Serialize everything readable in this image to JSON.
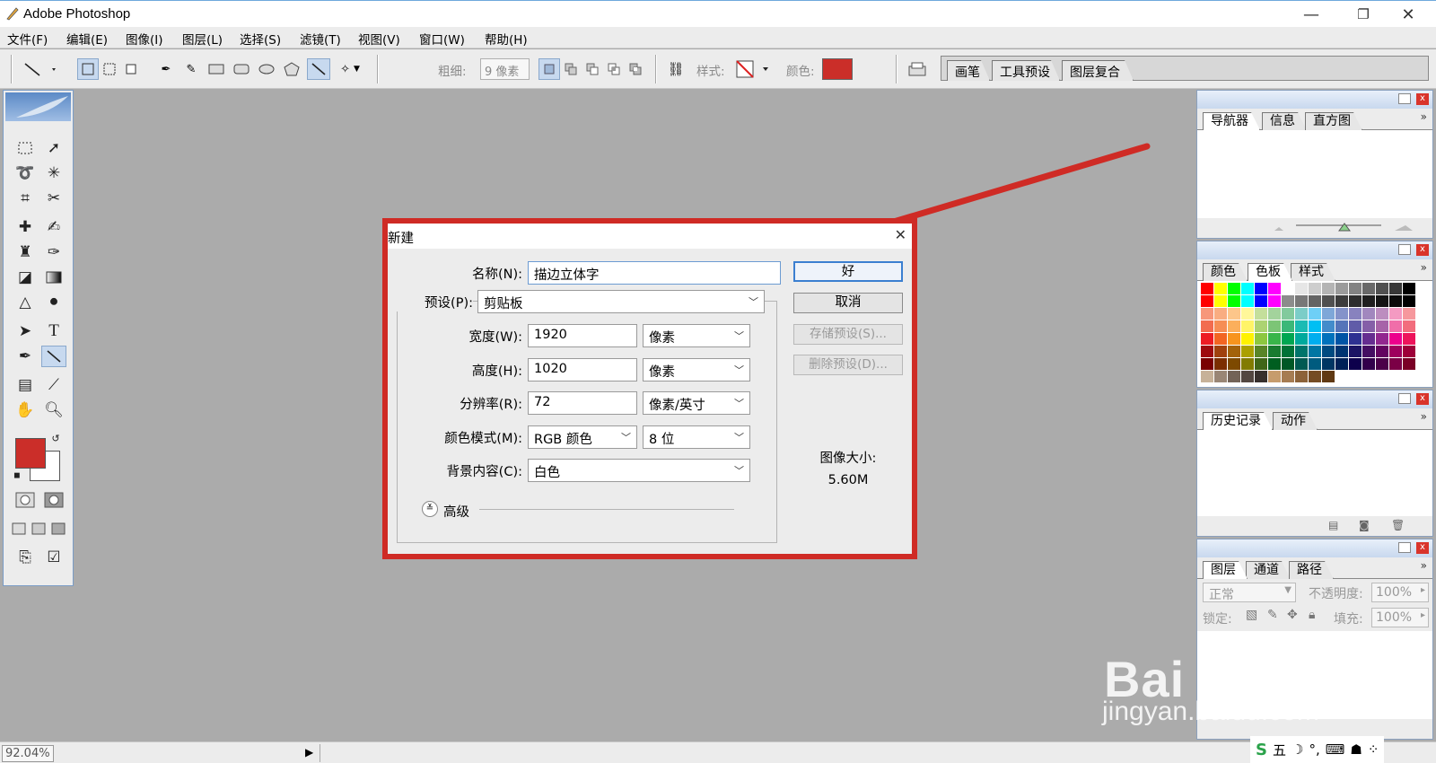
{
  "window": {
    "title": "Adobe Photoshop",
    "minimize": "—",
    "restore": "❐",
    "close": "✕"
  },
  "menu": [
    "文件(F)",
    "编辑(E)",
    "图像(I)",
    "图层(L)",
    "选择(S)",
    "滤镜(T)",
    "视图(V)",
    "窗口(W)",
    "帮助(H)"
  ],
  "options": {
    "weight_label": "粗细:",
    "weight_value": "9 像素",
    "style_label": "样式:",
    "color_label": "颜色:",
    "color_value": "#cb2e29"
  },
  "well_tabs": [
    "画笔",
    "工具预设",
    "图层复合"
  ],
  "status": {
    "zoom": "92.04%"
  },
  "panels": {
    "navigator": {
      "tabs": [
        "导航器",
        "信息",
        "直方图"
      ]
    },
    "swatches": {
      "tabs": [
        "颜色",
        "色板",
        "样式"
      ]
    },
    "history": {
      "tabs": [
        "历史记录",
        "动作"
      ]
    },
    "layers": {
      "tabs": [
        "图层",
        "通道",
        "路径"
      ],
      "blend_mode": "正常",
      "opacity_label": "不透明度:",
      "opacity_value": "100%",
      "lock_label": "锁定:",
      "fill_label": "填充:",
      "fill_value": "100%"
    }
  },
  "dialog": {
    "title": "新建",
    "close": "✕",
    "name_label": "名称(N):",
    "name_value": "描边立体字",
    "preset_label": "预设(P):",
    "preset_value": "剪贴板",
    "width_label": "宽度(W):",
    "width_value": "1920",
    "width_unit": "像素",
    "height_label": "高度(H):",
    "height_value": "1020",
    "height_unit": "像素",
    "resolution_label": "分辨率(R):",
    "resolution_value": "72",
    "resolution_unit": "像素/英寸",
    "color_mode_label": "颜色模式(M):",
    "color_mode_value": "RGB 颜色",
    "bit_depth_value": "8 位",
    "background_label": "背景内容(C):",
    "background_value": "白色",
    "advanced_label": "高级",
    "ok": "好",
    "cancel": "取消",
    "save_preset": "存储预设(S)...",
    "delete_preset": "删除预设(D)...",
    "image_size_label": "图像大小:",
    "image_size_value": "5.60M"
  },
  "annotation": {
    "arrow_color": "#cf2b25"
  },
  "watermark": {
    "logo": "Bai du 经验",
    "url": "jingyan.baidu.com"
  },
  "tray": {
    "ime_label": "五"
  }
}
